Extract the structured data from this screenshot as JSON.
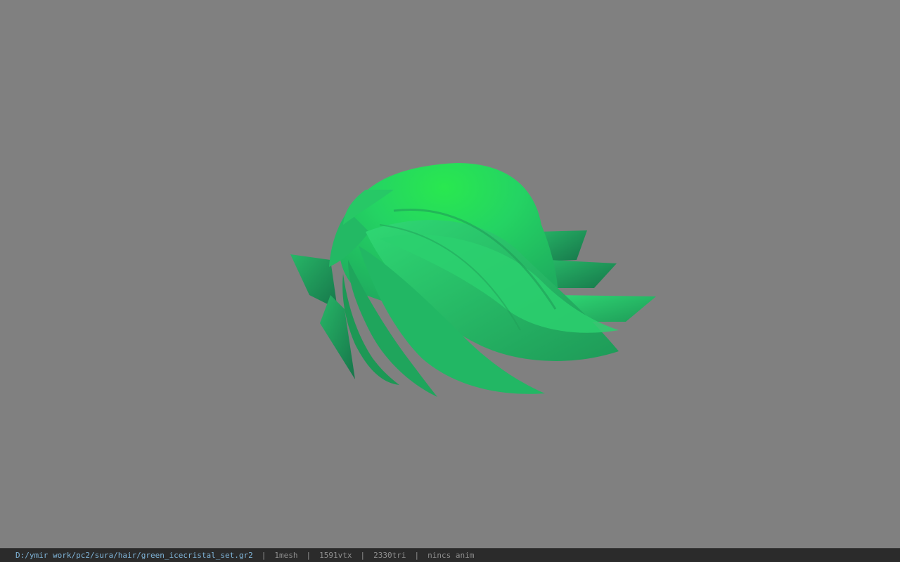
{
  "viewer": {
    "background_color": "#808080",
    "model_primary_color": "#2ecc71",
    "model_highlight_color": "#29e84f",
    "model_shadow_color": "#1c8f4e"
  },
  "status_bar": {
    "file_path": "D:/ymir work/pc2/sura/hair/green_icecristal_set.gr2",
    "mesh_count": "1",
    "mesh_label": "mesh",
    "vertex_count": "1591",
    "vertex_label": "vtx",
    "triangle_count": "2330",
    "triangle_label": "tri",
    "anim_info": "nincs anim",
    "separator": "|"
  }
}
